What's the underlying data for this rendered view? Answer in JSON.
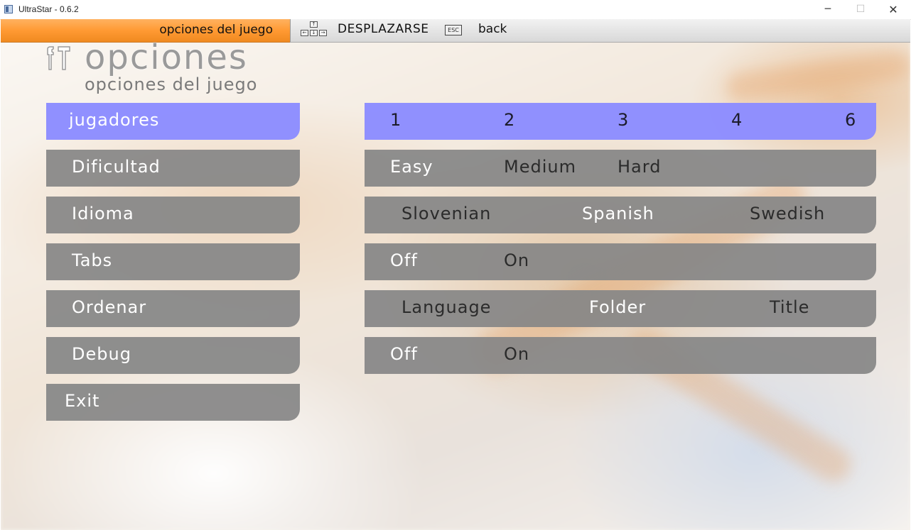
{
  "window": {
    "title": "UltraStar - 0.6.2",
    "minimize": "─",
    "maximize": "☐",
    "close": "✕"
  },
  "header": {
    "section_label": "opciones del juego",
    "nav_hint": "DESPLAZARSE",
    "esc_key": "ESC",
    "back_hint": "back",
    "arrow_keys": {
      "up": "↑",
      "left": "←",
      "down": "↓",
      "right": "→"
    }
  },
  "page": {
    "title": "opciones",
    "subtitle": "opciones del juego",
    "icon": "tools-icon"
  },
  "menu": [
    {
      "label": "jugadores",
      "selected": true
    },
    {
      "label": "Dificultad",
      "selected": false
    },
    {
      "label": "Idioma",
      "selected": false
    },
    {
      "label": "Tabs",
      "selected": false
    },
    {
      "label": "Ordenar",
      "selected": false
    },
    {
      "label": "Debug",
      "selected": false
    },
    {
      "label": "Exit",
      "selected": false
    }
  ],
  "options": [
    {
      "values": [
        "1",
        "2",
        "3",
        "4",
        "6"
      ],
      "active": "1"
    },
    {
      "values": [
        "Easy",
        "Medium",
        "Hard"
      ],
      "active": "Easy"
    },
    {
      "values": [
        "Slovenian",
        "Spanish",
        "Swedish"
      ],
      "active": "Spanish"
    },
    {
      "values": [
        "Off",
        "On"
      ],
      "active": "Off"
    },
    {
      "values": [
        "Language",
        "Folder",
        "Title"
      ],
      "active": "Folder"
    },
    {
      "values": [
        "Off",
        "On"
      ],
      "active": "Off"
    }
  ],
  "colors": {
    "accent_orange": "#ff9a33",
    "selected_blue": "#8c8cff",
    "button_grey": "#878787"
  }
}
